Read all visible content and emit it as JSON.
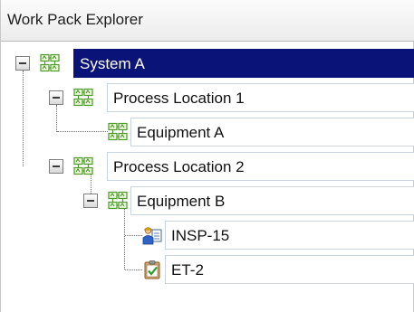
{
  "panel": {
    "title": "Work Pack Explorer"
  },
  "colors": {
    "selection": "#0a1478",
    "row_border": "#c9d3df",
    "tree_line": "#6f6f6f"
  },
  "tree": {
    "system_a": {
      "label": "System A",
      "icon": "location-hierarchy-icon",
      "selected": true
    },
    "process_location_1": {
      "label": "Process Location 1",
      "icon": "location-hierarchy-icon"
    },
    "equipment_a": {
      "label": "Equipment A",
      "icon": "location-hierarchy-icon"
    },
    "process_location_2": {
      "label": "Process Location 2",
      "icon": "location-hierarchy-icon"
    },
    "equipment_b": {
      "label": "Equipment B",
      "icon": "location-hierarchy-icon"
    },
    "insp_15": {
      "label": "INSP-15",
      "icon": "inspection-document-icon"
    },
    "et_2": {
      "label": "ET-2",
      "icon": "task-clipboard-icon"
    }
  }
}
